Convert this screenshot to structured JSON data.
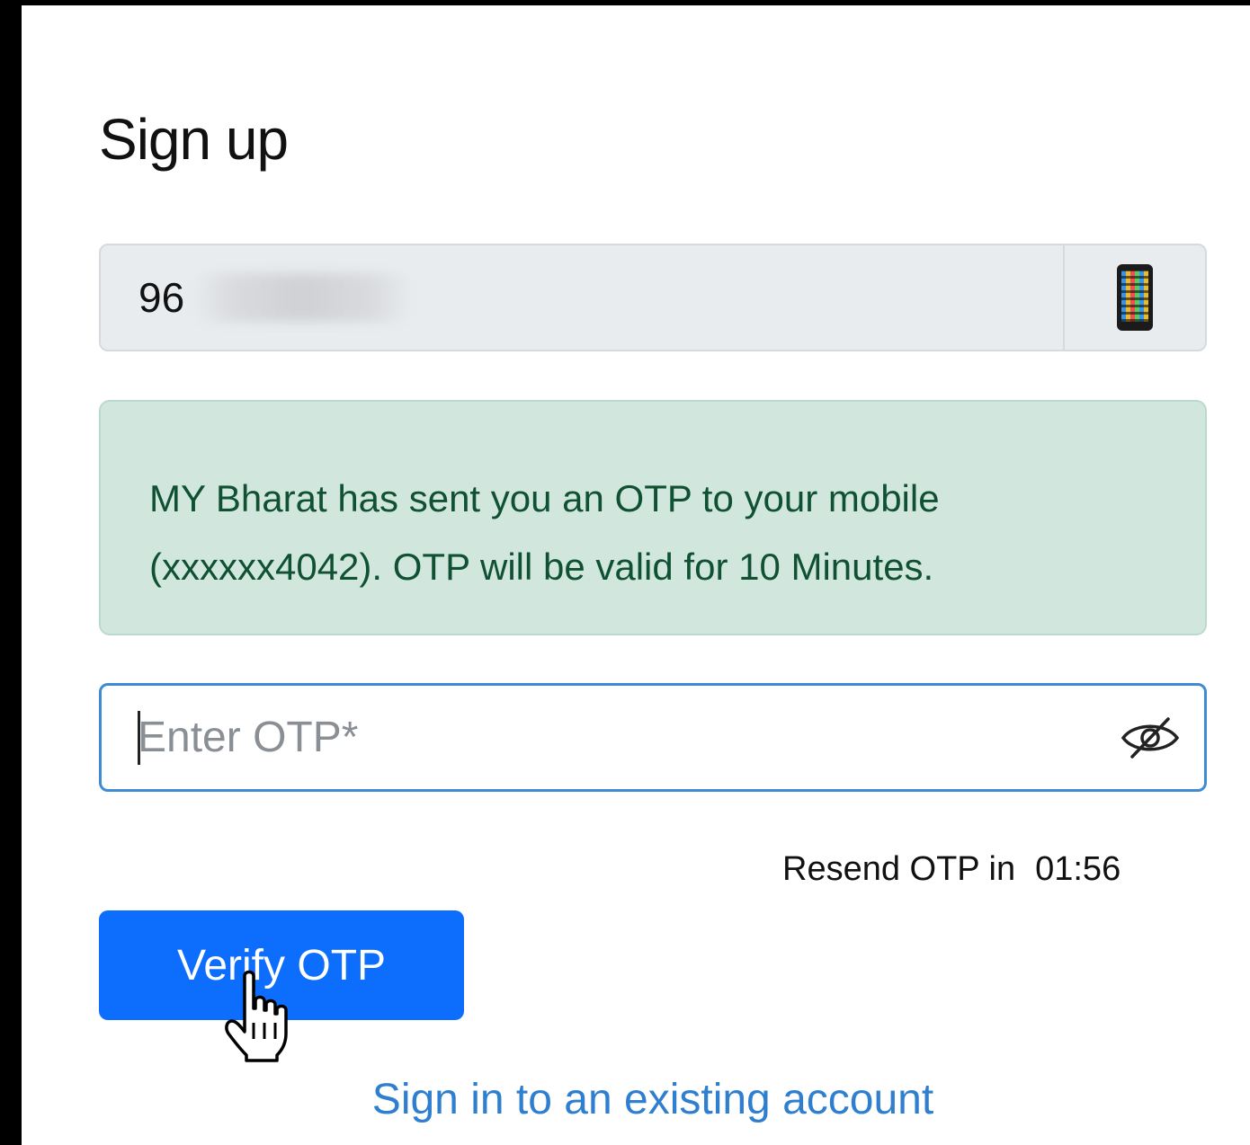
{
  "form": {
    "title": "Sign up",
    "phone_value_prefix": "96",
    "phone_icon": "mobile-phone-icon",
    "alert_line1": "MY Bharat has sent you an OTP to your mobile",
    "alert_line2": "(xxxxxx4042). OTP will be valid for 10 Minutes.",
    "otp_placeholder": "Enter OTP*",
    "otp_visibility_icon": "eye-slash-icon",
    "resend_label": "Resend OTP in",
    "resend_timer": "01:56",
    "verify_label": "Verify OTP",
    "signin_link": "Sign in to an existing account"
  },
  "colors": {
    "primary": "#0d6efd",
    "link": "#2f7fd0",
    "alert_bg": "#d1e7dd",
    "alert_text": "#0f5132",
    "input_focus_border": "#3d8bd4"
  }
}
